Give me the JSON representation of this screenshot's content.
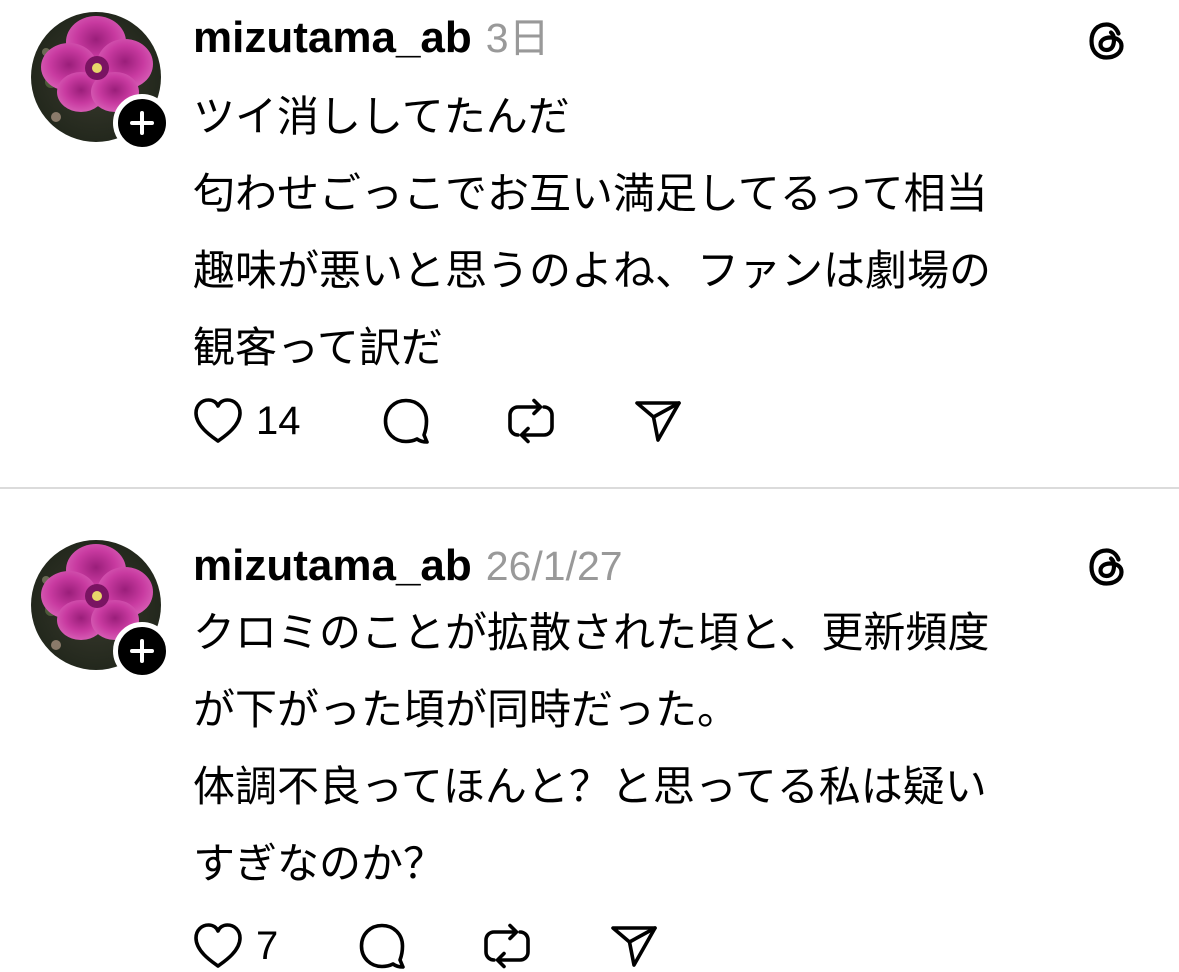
{
  "posts": [
    {
      "username": "mizutama_ab",
      "timestamp": "3日",
      "lines": [
        "ツイ消ししてたんだ",
        "匂わせごっこでお互い満足してるって相当",
        "趣味が悪いと思うのよね、ファンは劇場の",
        "観客って訳だ"
      ],
      "likes": "14",
      "icons": {
        "avatar": "flower-avatar",
        "follow": "plus-icon",
        "app": "threads-icon",
        "like": "heart-icon",
        "reply": "comment-icon",
        "repost": "repost-icon",
        "share": "send-icon"
      }
    },
    {
      "username": "mizutama_ab",
      "timestamp": "26/1/27",
      "lines": [
        "クロミのことが拡散された頃と、更新頻度",
        "が下がった頃が同時だった。",
        "体調不良ってほんと？と思ってる私は疑い",
        "すぎなのか？"
      ],
      "likes": "7",
      "icons": {
        "avatar": "flower-avatar",
        "follow": "plus-icon",
        "app": "threads-icon",
        "like": "heart-icon",
        "reply": "comment-icon",
        "repost": "repost-icon",
        "share": "send-icon"
      }
    }
  ],
  "colors": {
    "text": "#000000",
    "timestamp": "#999999",
    "divider": "#dbdbdb",
    "avatar_flower": "#b5308f"
  }
}
